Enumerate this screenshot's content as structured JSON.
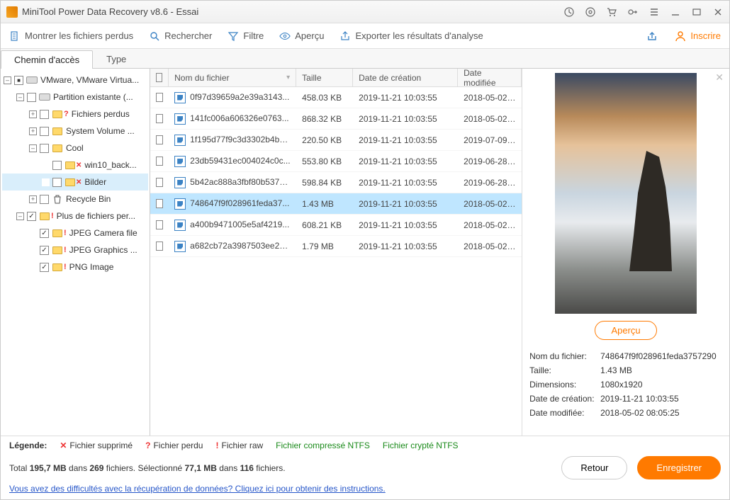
{
  "window": {
    "title": "MiniTool Power Data Recovery v8.6 - Essai"
  },
  "toolbar": {
    "show_lost": "Montrer les fichiers perdus",
    "search": "Rechercher",
    "filter": "Filtre",
    "preview": "Aperçu",
    "export": "Exporter les résultats d'analyse",
    "subscribe": "Inscrire"
  },
  "tabs": {
    "path": "Chemin d'accès",
    "type": "Type"
  },
  "tree": [
    {
      "indent": 0,
      "toggle": "–",
      "chk": "mixed",
      "icon": "disk",
      "label": "VMware, VMware Virtua..."
    },
    {
      "indent": 1,
      "toggle": "–",
      "chk": "",
      "icon": "disk",
      "label": "Partition existante (..."
    },
    {
      "indent": 2,
      "toggle": "+",
      "chk": "",
      "icon": "folder",
      "badge": "?",
      "label": "Fichiers perdus"
    },
    {
      "indent": 2,
      "toggle": "+",
      "chk": "",
      "icon": "folder",
      "label": "System Volume ..."
    },
    {
      "indent": 2,
      "toggle": "–",
      "chk": "",
      "icon": "folder",
      "label": "Cool"
    },
    {
      "indent": 3,
      "toggle": "",
      "chk": "",
      "icon": "folder",
      "badge": "x",
      "label": "win10_back..."
    },
    {
      "indent": 3,
      "toggle": "",
      "chk": "",
      "icon": "folder",
      "badge": "x",
      "label": "Bilder",
      "selected": true
    },
    {
      "indent": 2,
      "toggle": "+",
      "chk": "",
      "icon": "bin",
      "label": "Recycle Bin"
    },
    {
      "indent": 1,
      "toggle": "–",
      "chk": "checked",
      "icon": "folder",
      "badge": "!",
      "label": "Plus de fichiers per..."
    },
    {
      "indent": 2,
      "toggle": "",
      "chk": "checked",
      "icon": "folder",
      "badge": "!",
      "label": "JPEG Camera file"
    },
    {
      "indent": 2,
      "toggle": "",
      "chk": "checked",
      "icon": "folder",
      "badge": "!",
      "label": "JPEG Graphics ..."
    },
    {
      "indent": 2,
      "toggle": "",
      "chk": "checked",
      "icon": "folder",
      "badge": "!",
      "label": "PNG Image"
    }
  ],
  "filelist": {
    "columns": {
      "name": "Nom du fichier",
      "size": "Taille",
      "created": "Date de création",
      "modified": "Date modifiée"
    },
    "rows": [
      {
        "name": "0f97d39659a2e39a3143...",
        "size": "458.03 KB",
        "created": "2019-11-21 10:03:55",
        "modified": "2018-05-02 ..."
      },
      {
        "name": "141fc006a606326e0763...",
        "size": "868.32 KB",
        "created": "2019-11-21 10:03:55",
        "modified": "2018-05-02 ..."
      },
      {
        "name": "1f195d77f9c3d3302b4b9...",
        "size": "220.50 KB",
        "created": "2019-11-21 10:03:55",
        "modified": "2019-07-09 ..."
      },
      {
        "name": "23db59431ec004024c0c...",
        "size": "553.80 KB",
        "created": "2019-11-21 10:03:55",
        "modified": "2019-06-28 ..."
      },
      {
        "name": "5b42ac888a3fbf80b537e...",
        "size": "598.84 KB",
        "created": "2019-11-21 10:03:55",
        "modified": "2019-06-28 ..."
      },
      {
        "name": "748647f9f028961feda37...",
        "size": "1.43 MB",
        "created": "2019-11-21 10:03:55",
        "modified": "2018-05-02 ...",
        "selected": true
      },
      {
        "name": "a400b9471005e5af4219...",
        "size": "608.21 KB",
        "created": "2019-11-21 10:03:55",
        "modified": "2018-05-02 ..."
      },
      {
        "name": "a682cb72a3987503ee22...",
        "size": "1.79 MB",
        "created": "2019-11-21 10:03:55",
        "modified": "2018-05-02 ..."
      }
    ]
  },
  "preview": {
    "button": "Aperçu",
    "labels": {
      "name": "Nom du fichier:",
      "size": "Taille:",
      "dims": "Dimensions:",
      "created": "Date de création:",
      "modified": "Date modifiée:"
    },
    "values": {
      "name": "748647f9f028961feda3757290",
      "size": "1.43 MB",
      "dims": "1080x1920",
      "created": "2019-11-21 10:03:55",
      "modified": "2018-05-02 08:05:25"
    }
  },
  "legend": {
    "label": "Légende:",
    "deleted": "Fichier supprimé",
    "lost": "Fichier perdu",
    "raw": "Fichier raw",
    "ntfs_compressed": "Fichier compressé NTFS",
    "ntfs_encrypted": "Fichier crypté NTFS"
  },
  "status": {
    "line_prefix": "Total ",
    "total_mb": "195,7 MB",
    "mid1": " dans ",
    "total_files": "269",
    "mid2": " fichiers.  Sélectionné ",
    "sel_mb": "77,1 MB",
    "mid3": " dans ",
    "sel_files": "116",
    "suffix": " fichiers.",
    "back": "Retour",
    "save": "Enregistrer"
  },
  "help": {
    "link": "Vous avez des difficultés avec la récupération de données? Cliquez ici pour obtenir des instructions."
  }
}
